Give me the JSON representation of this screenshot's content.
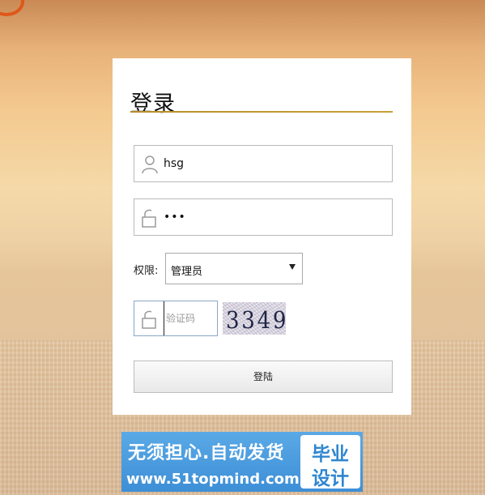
{
  "login": {
    "title": "登录",
    "username": {
      "value": "hsg"
    },
    "password": {
      "value": "•••"
    },
    "role": {
      "label": "权限:",
      "selected": "管理员"
    },
    "captcha": {
      "placeholder": "验证码",
      "image_text": "3349"
    },
    "submit_label": "登陆"
  },
  "ad": {
    "line1": "无须担心.自动发货",
    "line2": "www.51topmind.com",
    "badge_line1": "毕业",
    "badge_line2": "设计"
  },
  "colors": {
    "title_rule": "#b98b2a",
    "ad_background": "#3d8fd6",
    "captcha_text": "#1e2545"
  },
  "icons": {
    "username": "user-icon",
    "password": "lock-icon",
    "captcha": "lock-icon",
    "select_arrow": "caret-down-icon"
  }
}
